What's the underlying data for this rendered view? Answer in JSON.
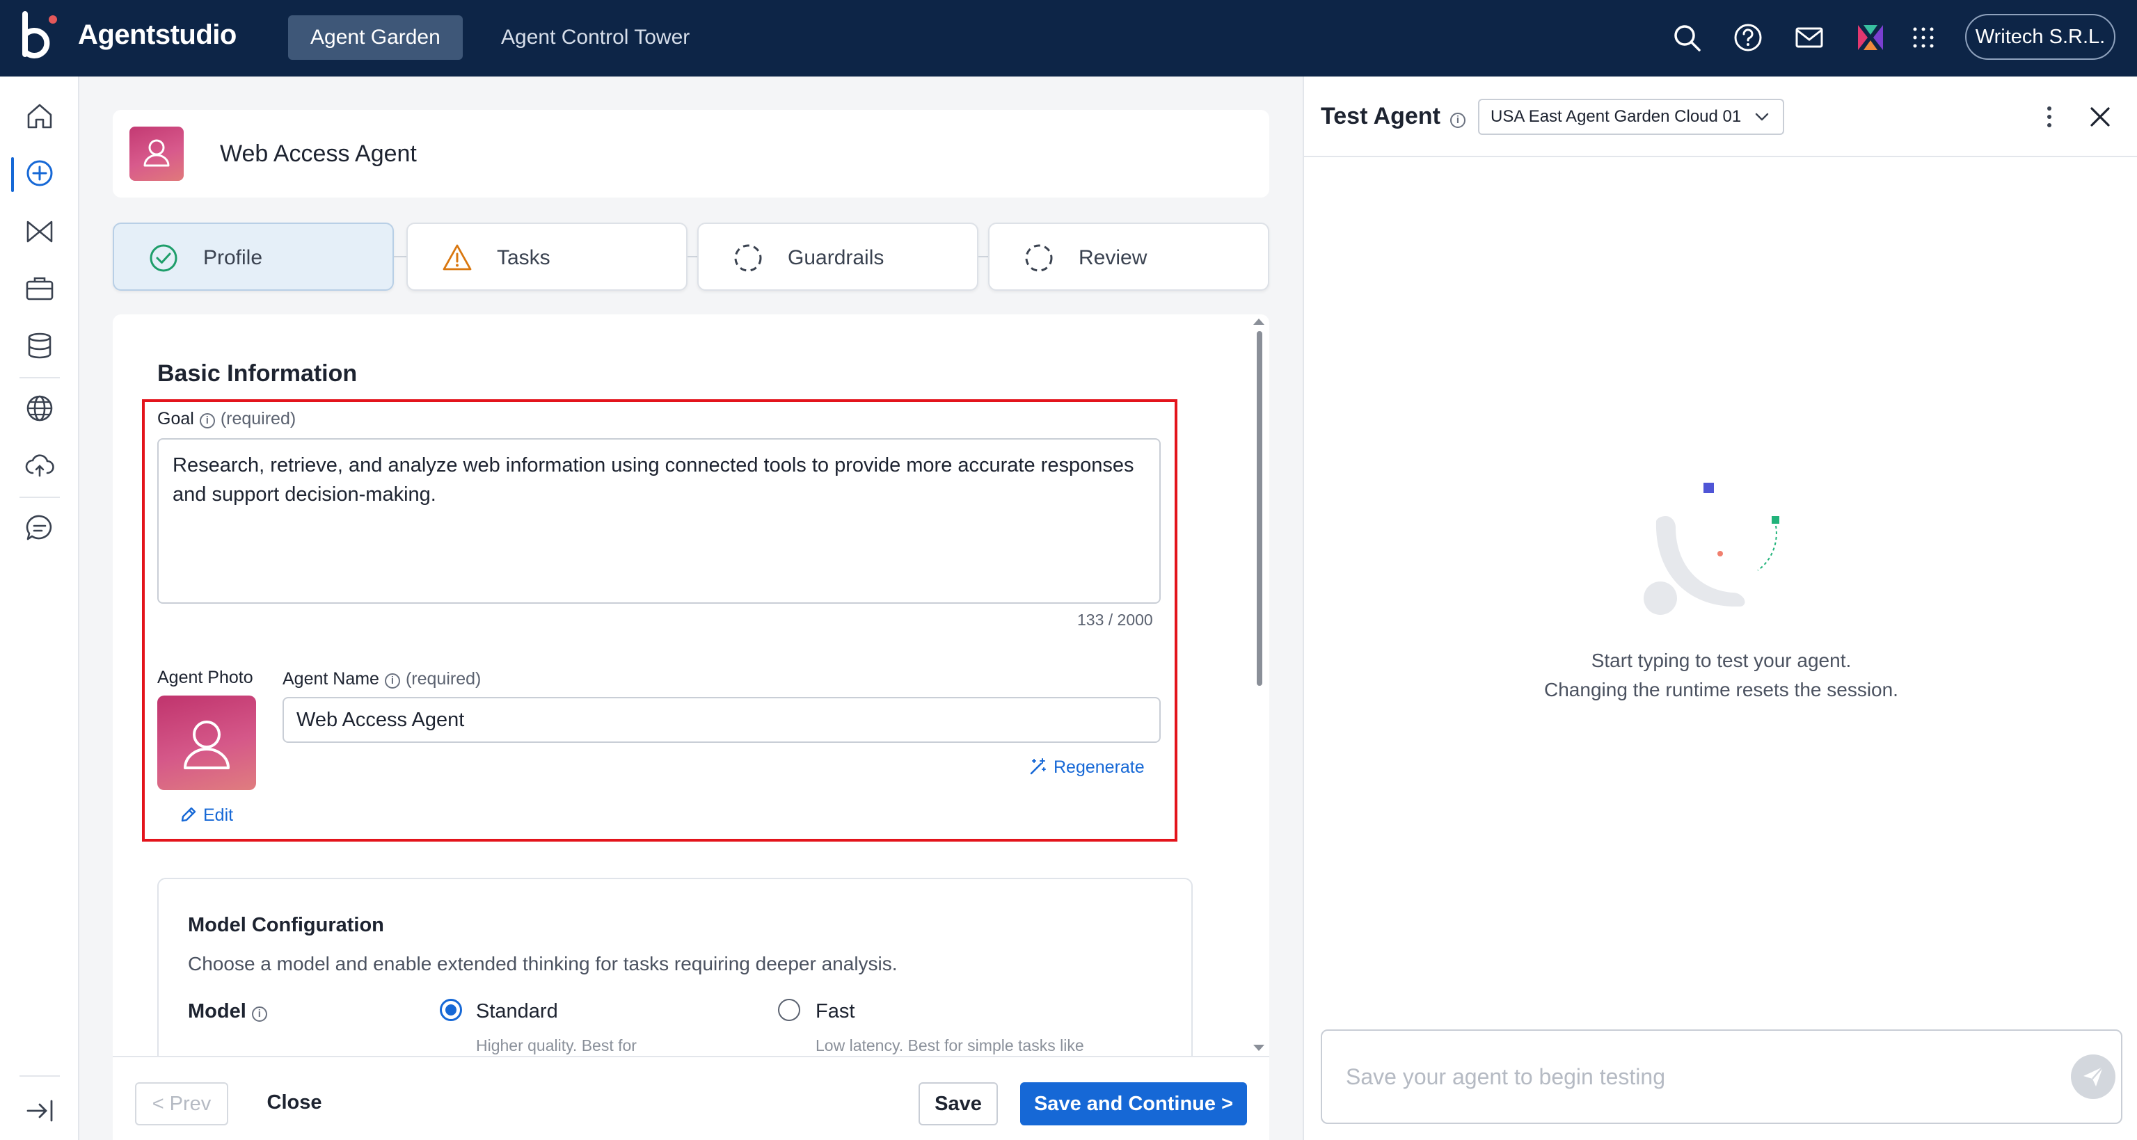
{
  "app": {
    "brand": "Agentstudio",
    "nav_tabs": [
      {
        "label": "Agent Garden",
        "active": true
      },
      {
        "label": "Agent Control Tower",
        "active": false
      }
    ],
    "org_button": "Writech S.R.L.",
    "top_icons": [
      "search-icon",
      "help-icon",
      "mail-icon",
      "app-logo-icon",
      "apps-grid-icon"
    ],
    "accent_color": "#1668d6",
    "header_bg": "#0d2547"
  },
  "rail": {
    "items": [
      "home-icon",
      "create-icon",
      "agents-icon",
      "toolbox-icon",
      "database-icon",
      "globe-icon",
      "cloud-upload-icon",
      "chat-icon"
    ],
    "active": "create-icon",
    "bottom": "collapse-icon"
  },
  "agent": {
    "name": "Web Access Agent"
  },
  "steps": [
    {
      "label": "Profile",
      "status": "complete"
    },
    {
      "label": "Tasks",
      "status": "warning"
    },
    {
      "label": "Guardrails",
      "status": "pending"
    },
    {
      "label": "Review",
      "status": "pending"
    }
  ],
  "basic_info": {
    "title": "Basic Information",
    "goal_label": "Goal",
    "required_text": "(required)",
    "goal_value": "Research, retrieve, and analyze web information using connected tools to provide more accurate responses and support decision-making.",
    "counter": "133 / 2000",
    "photo_label": "Agent Photo",
    "name_label": "Agent Name",
    "name_value": "Web Access Agent",
    "edit_label": "Edit",
    "regenerate_label": "Regenerate"
  },
  "model_config": {
    "title": "Model Configuration",
    "description": "Choose a model and enable extended thinking for tasks requiring deeper analysis.",
    "model_label": "Model",
    "options": [
      {
        "label": "Standard",
        "sub": "Higher quality. Best for",
        "selected": true
      },
      {
        "label": "Fast",
        "sub": "Low latency. Best for simple tasks like",
        "selected": false
      }
    ]
  },
  "footer": {
    "prev": "< Prev",
    "close": "Close",
    "save": "Save",
    "save_continue": "Save and Continue >"
  },
  "test_panel": {
    "title": "Test Agent",
    "runtime": "USA East Agent Garden Cloud 01",
    "empty_line1": "Start typing to test your agent.",
    "empty_line2": "Changing the runtime resets the session.",
    "input_placeholder": "Save your agent to begin testing"
  }
}
